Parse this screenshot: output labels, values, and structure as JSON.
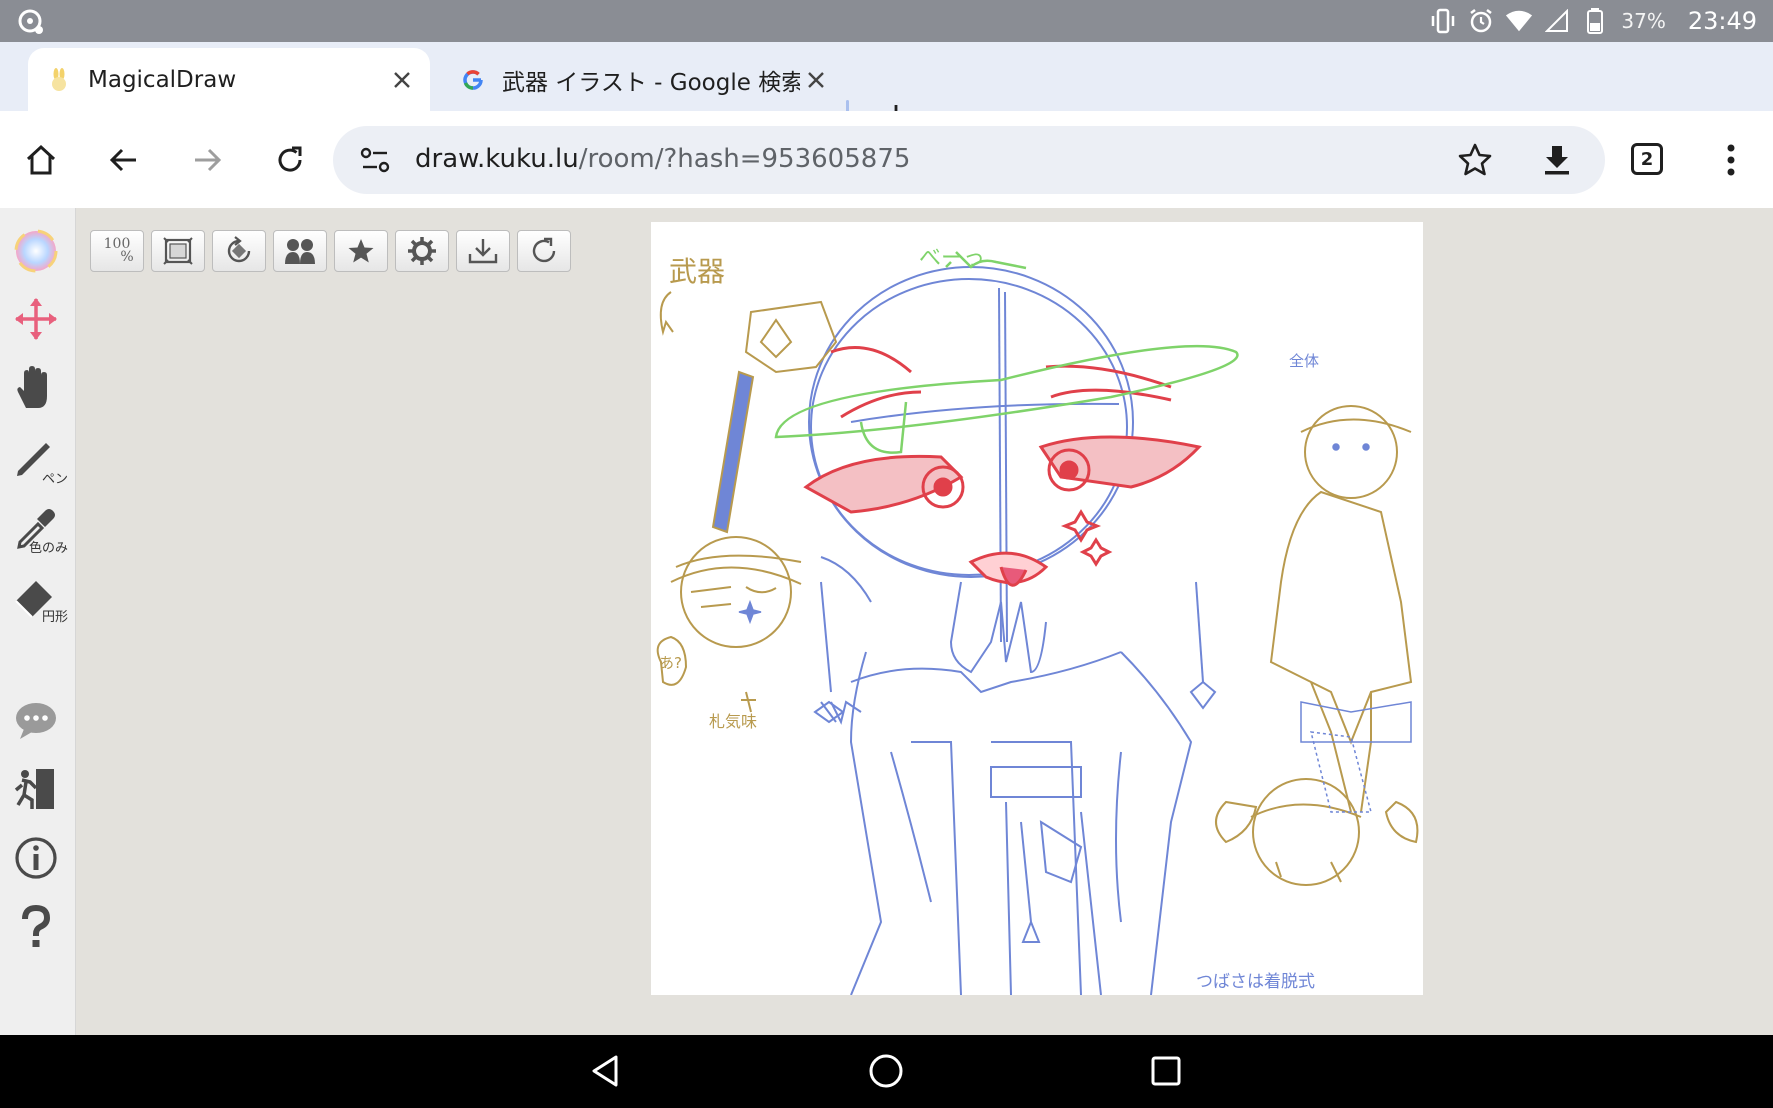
{
  "status_bar": {
    "battery_percent": "37%",
    "clock": "23:49",
    "icons": [
      "vibrate-icon",
      "alarm-icon",
      "wifi-icon",
      "cell-signal-icon",
      "battery-icon"
    ]
  },
  "tabs": [
    {
      "title": "MagicalDraw",
      "favicon": "rabbit-favicon-icon",
      "active": true
    },
    {
      "title": "武器 イラスト - Google 検索",
      "favicon": "google-favicon-icon",
      "active": false
    }
  ],
  "toolbar": {
    "url_host": "draw.kuku.lu",
    "url_path": "/room/?hash=953605875",
    "tab_count": "2"
  },
  "tools": [
    {
      "name": "color-picker-tool",
      "caption": ""
    },
    {
      "name": "move-tool",
      "caption": ""
    },
    {
      "name": "hand-tool",
      "caption": ""
    },
    {
      "name": "pen-tool",
      "caption": "ペン"
    },
    {
      "name": "eyedropper-tool",
      "caption": "色のみ"
    },
    {
      "name": "eraser-tool",
      "caption": "円形"
    }
  ],
  "canvas_tools": {
    "zoom_label_top": "100",
    "zoom_label_bottom": "%"
  },
  "drawing_labels": {
    "weapon": "武器",
    "bee": "べーっ",
    "whole": "全体",
    "question": "あ?",
    "flavor": "札気味",
    "wings": "つばさは着脱式"
  },
  "colors": {
    "sketch_blue": "#6f86d6",
    "sketch_gold": "#b89a4e",
    "sketch_red": "#e0404a",
    "sketch_green": "#7fd36a",
    "accent_pink": "#e85a7a"
  }
}
